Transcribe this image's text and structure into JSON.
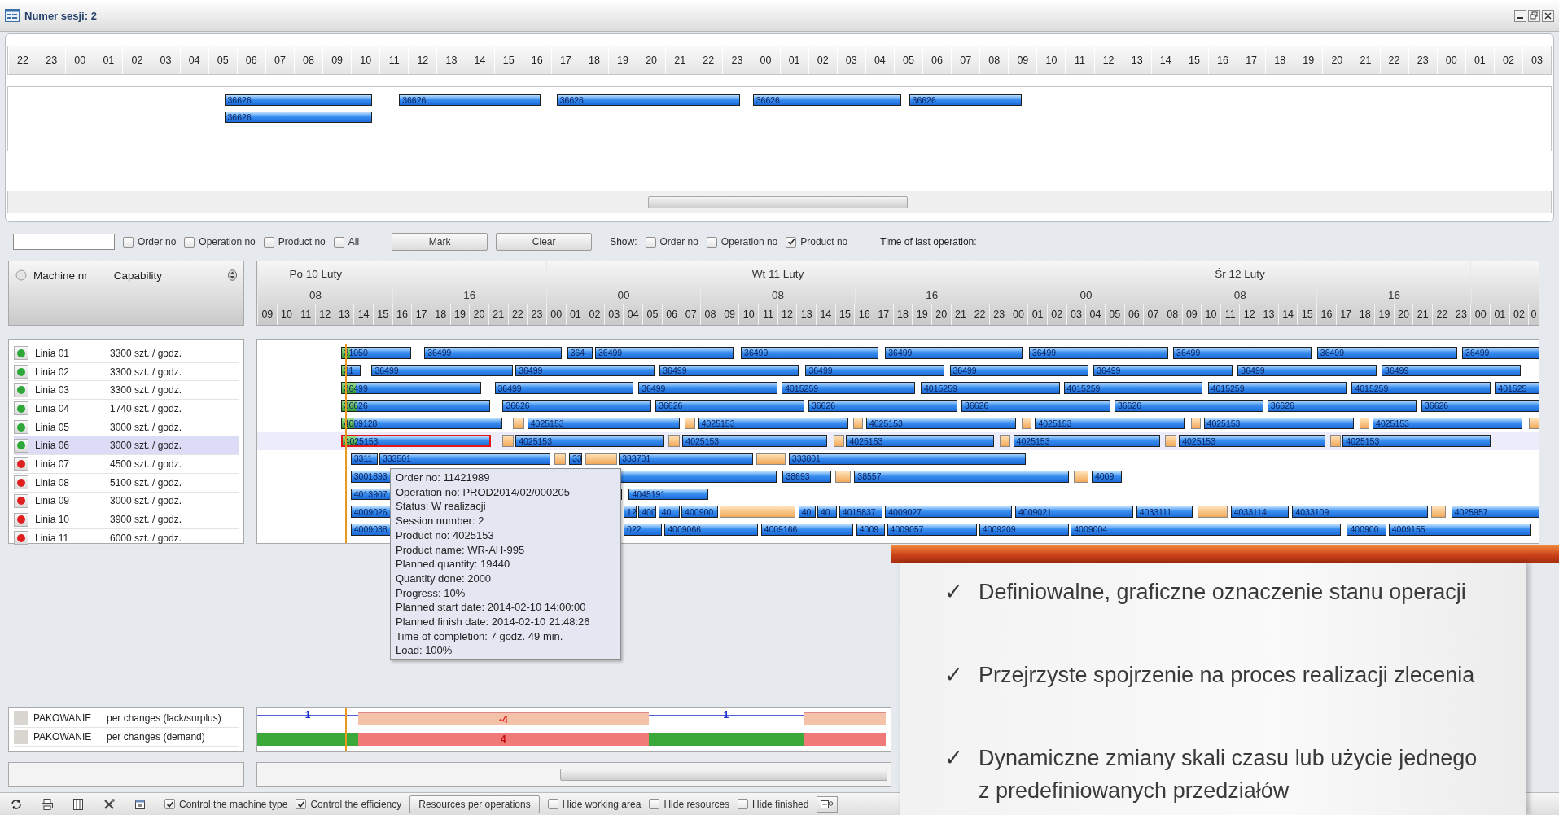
{
  "window": {
    "title": "Numer sesji: 2"
  },
  "overview": {
    "hours": [
      "22",
      "23",
      "00",
      "01",
      "02",
      "03",
      "04",
      "05",
      "06",
      "07",
      "08",
      "09",
      "10",
      "11",
      "12",
      "13",
      "14",
      "15",
      "16",
      "17",
      "18",
      "19",
      "20",
      "21",
      "22",
      "23",
      "00",
      "01",
      "02",
      "03",
      "04",
      "05",
      "06",
      "07",
      "08",
      "09",
      "10",
      "11",
      "12",
      "13",
      "14",
      "15",
      "16",
      "17",
      "18",
      "19",
      "20",
      "21",
      "22",
      "23",
      "00",
      "01",
      "02",
      "03"
    ],
    "lanes": [
      {
        "bars": [
          {
            "label": "36626",
            "kind": "order",
            "selected": false
          },
          {
            "label": "36626",
            "kind": "order",
            "selected": false
          },
          {
            "label": "36626",
            "kind": "order",
            "selected": false
          },
          {
            "label": "36626",
            "kind": "order",
            "selected": false
          },
          {
            "label": "36626",
            "kind": "order",
            "selected": false
          }
        ]
      },
      {
        "bars": [
          {
            "label": "36626",
            "kind": "order",
            "selected": false
          }
        ]
      }
    ]
  },
  "filter_bar": {
    "search_options": [
      {
        "label": "Order no",
        "checked": false
      },
      {
        "label": "Operation no",
        "checked": false
      },
      {
        "label": "Product no",
        "checked": false
      },
      {
        "label": "All",
        "checked": false
      }
    ],
    "buttons": [
      {
        "label": "Mark"
      },
      {
        "label": "Clear"
      }
    ],
    "show_label": "Show:",
    "show_options": [
      {
        "label": "Order no",
        "checked": false
      },
      {
        "label": "Operation no",
        "checked": false
      },
      {
        "label": "Product no",
        "checked": true
      }
    ],
    "last_operation_label": "Time of last operation:"
  },
  "machine_table": {
    "columns": [
      "Machine nr",
      "Capability"
    ]
  },
  "timeline": {
    "days": [
      "Po 10 Luty",
      "Wt 11 Luty",
      "Śr 12 Luty"
    ],
    "shifts": [
      "08",
      "16",
      "00",
      "08",
      "16",
      "00",
      "08",
      "16"
    ],
    "hours": [
      "09",
      "10",
      "11",
      "12",
      "13",
      "14",
      "15",
      "16",
      "17",
      "18",
      "19",
      "20",
      "21",
      "22",
      "23",
      "00",
      "01",
      "02",
      "03",
      "04",
      "05",
      "06",
      "07",
      "08",
      "09",
      "10",
      "11",
      "12",
      "13",
      "14",
      "15",
      "16",
      "17",
      "18",
      "19",
      "20",
      "21",
      "22",
      "23",
      "00",
      "01",
      "02",
      "03",
      "04",
      "05",
      "06",
      "07",
      "08",
      "09",
      "10",
      "11",
      "12",
      "13",
      "14",
      "15",
      "16",
      "17",
      "18",
      "19",
      "20",
      "21",
      "22",
      "23",
      "00",
      "01",
      "02"
    ],
    "hours_partial": "0"
  },
  "machines": [
    {
      "name": "Linia 01",
      "capability": "3300 szt. / godz.",
      "color": "#2fa83a",
      "selected": false,
      "bars": [
        {
          "label": "31050",
          "kind": "order",
          "selected": false,
          "level": 0.12
        },
        {
          "label": "36499",
          "kind": "order",
          "selected": false
        },
        {
          "label": "364",
          "kind": "order",
          "selected": false
        },
        {
          "label": "36499",
          "kind": "order",
          "selected": false
        },
        {
          "label": "36499",
          "kind": "order",
          "selected": false
        },
        {
          "label": "36499",
          "kind": "order",
          "selected": false
        },
        {
          "label": "36499",
          "kind": "order",
          "selected": false
        },
        {
          "label": "36499",
          "kind": "order",
          "selected": false
        },
        {
          "label": "36499",
          "kind": "order",
          "selected": false
        },
        {
          "label": "36499",
          "kind": "order",
          "selected": false
        }
      ]
    },
    {
      "name": "Linia 02",
      "capability": "3300 szt. / godz.",
      "color": "#2fa83a",
      "selected": false,
      "bars": [
        {
          "label": "31",
          "kind": "order",
          "selected": false,
          "level": 0.3
        },
        {
          "label": "36499",
          "kind": "order",
          "selected": false
        },
        {
          "label": "36499",
          "kind": "order",
          "selected": false
        },
        {
          "label": "36499",
          "kind": "order",
          "selected": false
        },
        {
          "label": "36499",
          "kind": "order",
          "selected": false
        },
        {
          "label": "36499",
          "kind": "order",
          "selected": false
        },
        {
          "label": "36499",
          "kind": "order",
          "selected": false
        },
        {
          "label": "36499",
          "kind": "order",
          "selected": false
        },
        {
          "label": "36499",
          "kind": "order",
          "selected": false
        }
      ]
    },
    {
      "name": "Linia 03",
      "capability": "3300 szt. / godz.",
      "color": "#2fa83a",
      "selected": false,
      "bars": [
        {
          "label": "36499",
          "kind": "order",
          "selected": false,
          "level": 0.1
        },
        {
          "label": "36499",
          "kind": "order",
          "selected": false
        },
        {
          "label": "36499",
          "kind": "order",
          "selected": false
        },
        {
          "label": "4015259",
          "kind": "order",
          "selected": false
        },
        {
          "label": "4015259",
          "kind": "order",
          "selected": false
        },
        {
          "label": "4015259",
          "kind": "order",
          "selected": false
        },
        {
          "label": "4015259",
          "kind": "order",
          "selected": false
        },
        {
          "label": "4015259",
          "kind": "order",
          "selected": false
        },
        {
          "label": "401525",
          "kind": "order",
          "selected": false
        }
      ]
    },
    {
      "name": "Linia 04",
      "capability": "1740 szt. / godz.",
      "color": "#2fa83a",
      "selected": false,
      "bars": [
        {
          "label": "36626",
          "kind": "order",
          "selected": false,
          "level": 0.1
        },
        {
          "label": "36626",
          "kind": "order",
          "selected": false
        },
        {
          "label": "36626",
          "kind": "order",
          "selected": false
        },
        {
          "label": "36626",
          "kind": "order",
          "selected": false
        },
        {
          "label": "36626",
          "kind": "order",
          "selected": false
        },
        {
          "label": "36626",
          "kind": "order",
          "selected": false
        },
        {
          "label": "36626",
          "kind": "order",
          "selected": false
        },
        {
          "label": "36626",
          "kind": "order",
          "selected": false
        }
      ]
    },
    {
      "name": "Linia 05",
      "capability": "3000 szt. / godz.",
      "color": "#2fa83a",
      "selected": false,
      "bars": [
        {
          "label": "4009128",
          "kind": "order",
          "selected": false,
          "level": 0.08
        },
        {
          "kind": "setup",
          "selected": false
        },
        {
          "label": "4025153",
          "kind": "order",
          "selected": false
        },
        {
          "kind": "setup",
          "selected": false
        },
        {
          "label": "4025153",
          "kind": "order",
          "selected": false
        },
        {
          "kind": "setup",
          "selected": false
        },
        {
          "label": "4025153",
          "kind": "order",
          "selected": false
        },
        {
          "kind": "setup",
          "selected": false
        },
        {
          "label": "4025153",
          "kind": "order",
          "selected": false
        },
        {
          "kind": "setup",
          "selected": false
        },
        {
          "label": "4025153",
          "kind": "order",
          "selected": false
        },
        {
          "kind": "setup",
          "selected": false
        },
        {
          "label": "4025153",
          "kind": "order",
          "selected": false
        },
        {
          "kind": "setup",
          "selected": false
        }
      ]
    },
    {
      "name": "Linia 06",
      "capability": "3000 szt. / godz.",
      "color": "#2fa83a",
      "selected": true,
      "bars": [
        {
          "label": "4025153",
          "kind": "order",
          "selected": true,
          "level": 0.1
        },
        {
          "kind": "setup",
          "selected": false
        },
        {
          "label": "4025153",
          "kind": "order",
          "selected": false
        },
        {
          "kind": "setup",
          "selected": false
        },
        {
          "label": "4025153",
          "kind": "order",
          "selected": false
        },
        {
          "kind": "setup",
          "selected": false
        },
        {
          "label": "4025153",
          "kind": "order",
          "selected": false
        },
        {
          "kind": "setup",
          "selected": false
        },
        {
          "label": "4025153",
          "kind": "order",
          "selected": false
        },
        {
          "kind": "setup",
          "selected": false
        },
        {
          "label": "4025153",
          "kind": "order",
          "selected": false
        },
        {
          "kind": "setup",
          "selected": false
        },
        {
          "label": "4025153",
          "kind": "order",
          "selected": false
        }
      ]
    },
    {
      "name": "Linia 07",
      "capability": "4500 szt. / godz.",
      "color": "#e02020",
      "selected": false,
      "bars": [
        {
          "label": "3311",
          "kind": "order",
          "selected": false
        },
        {
          "label": "333501",
          "kind": "order",
          "selected": false
        },
        {
          "kind": "setup",
          "selected": false
        },
        {
          "label": "33",
          "kind": "order",
          "selected": false
        },
        {
          "kind": "setup",
          "selected": false
        },
        {
          "label": "333701",
          "kind": "order",
          "selected": false
        },
        {
          "kind": "setup",
          "selected": false
        },
        {
          "label": "333801",
          "kind": "order",
          "selected": false
        }
      ]
    },
    {
      "name": "Linia 08",
      "capability": "5100 szt. / godz.",
      "color": "#e02020",
      "selected": false,
      "bars": [
        {
          "label": "3001893",
          "kind": "order",
          "selected": false
        },
        {
          "label": "38693",
          "kind": "order",
          "selected": false
        },
        {
          "kind": "setup",
          "selected": false
        },
        {
          "label": "38557",
          "kind": "order",
          "selected": false
        },
        {
          "kind": "setup",
          "selected": false
        },
        {
          "label": "4009",
          "kind": "order",
          "selected": false
        }
      ]
    },
    {
      "name": "Linia 09",
      "capability": "3000 szt. / godz.",
      "color": "#e02020",
      "selected": false,
      "bars": [
        {
          "label": "4013907",
          "kind": "order",
          "selected": false
        },
        {
          "label": "4045191",
          "kind": "order",
          "selected": false
        }
      ]
    },
    {
      "name": "Linia 10",
      "capability": "3900 szt. / godz.",
      "color": "#e02020",
      "selected": false,
      "bars": [
        {
          "label": "4009026",
          "kind": "order",
          "selected": false
        },
        {
          "label": "12",
          "kind": "order",
          "selected": false
        },
        {
          "label": "400",
          "kind": "order",
          "selected": false
        },
        {
          "label": "40",
          "kind": "order",
          "selected": false
        },
        {
          "label": "400900",
          "kind": "order",
          "selected": false
        },
        {
          "kind": "setup",
          "selected": false
        },
        {
          "label": "40",
          "kind": "order",
          "selected": false
        },
        {
          "label": "40",
          "kind": "order",
          "selected": false
        },
        {
          "label": "4015837",
          "kind": "order",
          "selected": false
        },
        {
          "label": "4009027",
          "kind": "order",
          "selected": false
        },
        {
          "label": "4009021",
          "kind": "order",
          "selected": false
        },
        {
          "label": "4033111",
          "kind": "order",
          "selected": false
        },
        {
          "kind": "setup",
          "selected": false
        },
        {
          "label": "4033114",
          "kind": "order",
          "selected": false
        },
        {
          "label": "4033109",
          "kind": "order",
          "selected": false
        },
        {
          "kind": "setup",
          "selected": false
        },
        {
          "label": "4025957",
          "kind": "order",
          "selected": false
        }
      ]
    },
    {
      "name": "Linia 11",
      "capability": "6000 szt. / godz.",
      "color": "#e02020",
      "selected": false,
      "bars": [
        {
          "label": "4009038",
          "kind": "order",
          "selected": false
        },
        {
          "label": "022",
          "kind": "order",
          "selected": false
        },
        {
          "label": "4009066",
          "kind": "order",
          "selected": false
        },
        {
          "label": "4009166",
          "kind": "order",
          "selected": false
        },
        {
          "label": "4009",
          "kind": "order",
          "selected": false
        },
        {
          "label": "4009057",
          "kind": "order",
          "selected": false
        },
        {
          "label": "4009209",
          "kind": "order",
          "selected": false
        },
        {
          "label": "4009004",
          "kind": "order",
          "selected": false
        },
        {
          "label": "400900",
          "kind": "order",
          "selected": false
        },
        {
          "label": "4009155",
          "kind": "order",
          "selected": false
        }
      ]
    }
  ],
  "tooltip": {
    "lines": [
      "Order no: 11421989",
      "Operation no: PROD2014/02/000205",
      "Status: W realizacji",
      "Session number: 2",
      "Product no: 4025153",
      "Product name: WR-AH-995",
      "Planned quantity: 19440",
      "Quantity done: 2000",
      "Progress: 10%",
      "Planned start date: 2014-02-10 14:00:00",
      "Planned finish date: 2014-02-10 21:48:26",
      "Time of completion: 7 godz. 49 min.",
      "Load: 100%"
    ]
  },
  "resources": [
    {
      "name": "PAKOWANIE",
      "type": "per changes (lack/surplus)",
      "segments": [
        {
          "kind": "surplus",
          "label": "1"
        },
        {
          "kind": "lack",
          "label": "-4"
        },
        {
          "kind": "surplus",
          "label": "1"
        },
        {
          "kind": "lack"
        }
      ]
    },
    {
      "name": "PAKOWANIE",
      "type": "per changes (demand)",
      "segments": [
        {
          "kind": "ok"
        },
        {
          "kind": "short",
          "label": "4"
        },
        {
          "kind": "ok"
        },
        {
          "kind": "short"
        }
      ]
    }
  ],
  "bottom_toolbar": {
    "items": [
      {
        "kind": "checkbox",
        "label": "Control the machine type",
        "checked": true
      },
      {
        "kind": "checkbox",
        "label": "Control the efficiency",
        "checked": true
      },
      {
        "kind": "button",
        "label": "Resources per operations"
      },
      {
        "kind": "checkbox",
        "label": "Hide working area",
        "checked": false
      },
      {
        "kind": "checkbox",
        "label": "Hide resources",
        "checked": false
      },
      {
        "kind": "checkbox",
        "label": "Hide finished",
        "checked": false
      }
    ]
  },
  "callout": {
    "items": [
      {
        "check": "✓",
        "text": "Definiowalne, graficzne oznaczenie stanu operacji"
      },
      {
        "check": "✓",
        "text": "Przejrzyste spojrzenie na proces realizacji zlecenia"
      },
      {
        "check": "✓",
        "text": "Dynamiczne zmiany skali czasu lub użycie jednego z predefiniowanych przedziałów"
      }
    ]
  }
}
